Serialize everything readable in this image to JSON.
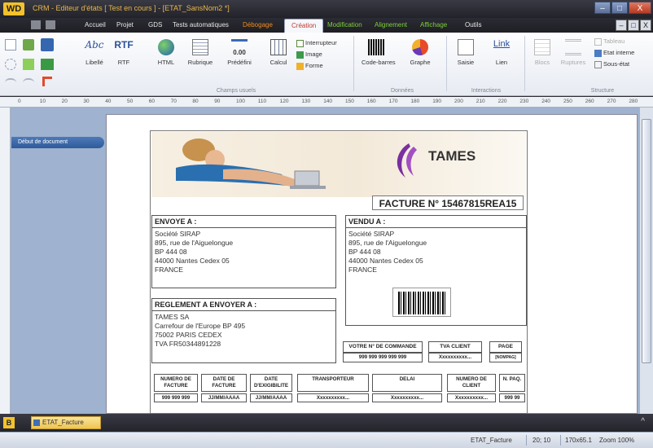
{
  "window": {
    "logo": "WD",
    "title": "CRM - Editeur d'états [ Test en cours ] - [ETAT_SansNom2 *]",
    "minimize": "–",
    "maximize": "□",
    "close": "X"
  },
  "menu": {
    "items": [
      "Accueil",
      "Projet",
      "GDS",
      "Tests automatiques",
      "Débogage",
      "Création",
      "Modification",
      "Alignement",
      "Affichage",
      "Outils"
    ],
    "active": "Création",
    "mdi": [
      "–",
      "□",
      "X"
    ]
  },
  "ribbon": {
    "groups": {
      "champs_usuels": "Champs usuels",
      "donnees": "Données",
      "interactions": "Interactions",
      "structure": "Structure"
    },
    "buttons": {
      "libelle": "Libellé",
      "rtf": "RTF",
      "html": "HTML",
      "rubrique": "Rubrique",
      "predefini": "Prédéfini",
      "calcul": "Calcul",
      "interrupteur": "Interrupteur",
      "image": "Image",
      "forme": "Forme",
      "code_barres": "Code-barres",
      "graphe": "Graphe",
      "saisie": "Saisie",
      "lien": "Lien",
      "blocs": "Blocs",
      "ruptures": "Ruptures",
      "tableau": "Tableau",
      "etat_interne": "Etat interne",
      "sous_etat": "Sous-état"
    },
    "icon_text": {
      "abc": "Abc",
      "rtf": "RTF",
      "link": "Link",
      "predefini_value": "0.00"
    }
  },
  "ruler": {
    "ticks": [
      "0",
      "10",
      "20",
      "30",
      "40",
      "50",
      "60",
      "70",
      "80",
      "90",
      "100",
      "110",
      "120",
      "130",
      "140",
      "150",
      "160",
      "170",
      "180",
      "190",
      "200",
      "210",
      "220",
      "230",
      "240",
      "250",
      "260",
      "270",
      "280"
    ]
  },
  "workspace": {
    "section_label": "Début de document"
  },
  "invoice": {
    "logo_text": "TAMES",
    "title": "FACTURE N° 15467815REA15",
    "envoye": {
      "head": "ENVOYE A :",
      "lines": [
        "Société SIRAP",
        "895, rue de l'Aiguelongue",
        "BP 444 08",
        "44000 Nantes Cedex 05",
        "FRANCE"
      ]
    },
    "vendu": {
      "head": "VENDU A :",
      "lines": [
        "Société SIRAP",
        "895, rue de l'Aiguelongue",
        "BP 444 08",
        "44000 Nantes Cedex 05",
        "FRANCE"
      ]
    },
    "reglement": {
      "head": "REGLEMENT A ENVOYER A :",
      "lines": [
        "TAMES SA",
        "Carrefour de l'Europe BP 495",
        "75002 PARIS CEDEX",
        "TVA FR50344891228"
      ]
    },
    "commande": {
      "heads": [
        "VOTRE N° DE COMMANDE",
        "TVA CLIENT",
        "PAGE"
      ],
      "values": [
        "999 999 999 999 999",
        "Xxxxxxxxxx...",
        "[NOMPAG]"
      ]
    },
    "columns": {
      "heads": [
        "NUMERO DE FACTURE",
        "DATE DE FACTURE",
        "DATE D'EXIGIBILITE",
        "TRANSPORTEUR",
        "DELAI",
        "NUMERO DE CLIENT",
        "N. PAQ."
      ],
      "values": [
        "999 999 999",
        "JJ/MM/AAAA",
        "JJ/MM/AAAA",
        "Xxxxxxxxxx...",
        "Xxxxxxxxxx...",
        "Xxxxxxxxxx...",
        "999 99"
      ]
    }
  },
  "taskbar": {
    "icon": "B",
    "tab": "ETAT_Facture",
    "caret": "^"
  },
  "status": {
    "etat": "ETAT_Facture",
    "position": "20; 10",
    "size": "170x65.1",
    "zoom": "Zoom 100%"
  }
}
